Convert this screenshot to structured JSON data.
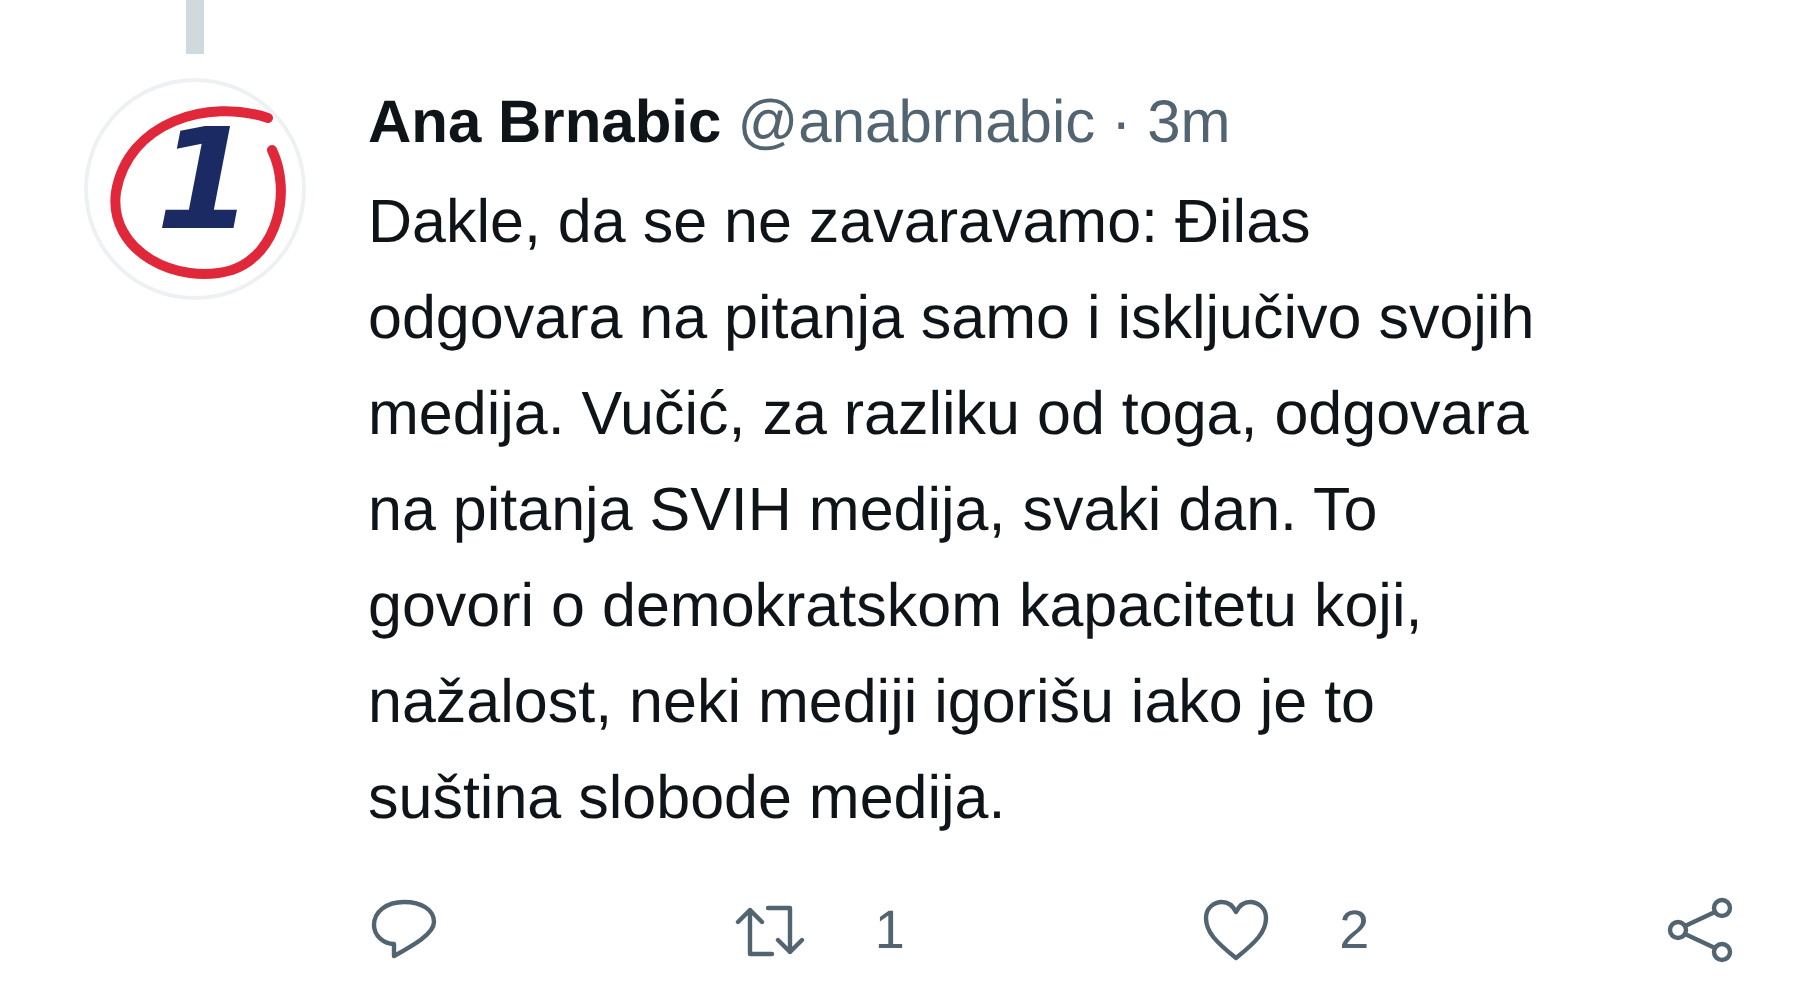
{
  "tweet": {
    "avatar_text": "1",
    "name": "Ana Brnabic",
    "handle": "@anabrnabic",
    "separator": "·",
    "time": "3m",
    "text": "Dakle, da se ne zavaravamo: Đilas\nodgovara na pitanja samo i isključivo svojih\nmedija. Vučić, za razliku od toga, odgovara\nna pitanja SVIH medija, svaki dan. To\ngovori o demokratskom kapacitetu koji,\nnažalost, neki mediji igorišu iako je to\nsuština slobode medija.",
    "actions": [
      {
        "kind": "reply"
      },
      {
        "kind": "retweet",
        "count": "1"
      },
      {
        "kind": "like",
        "count": "2"
      },
      {
        "kind": "share"
      }
    ]
  }
}
